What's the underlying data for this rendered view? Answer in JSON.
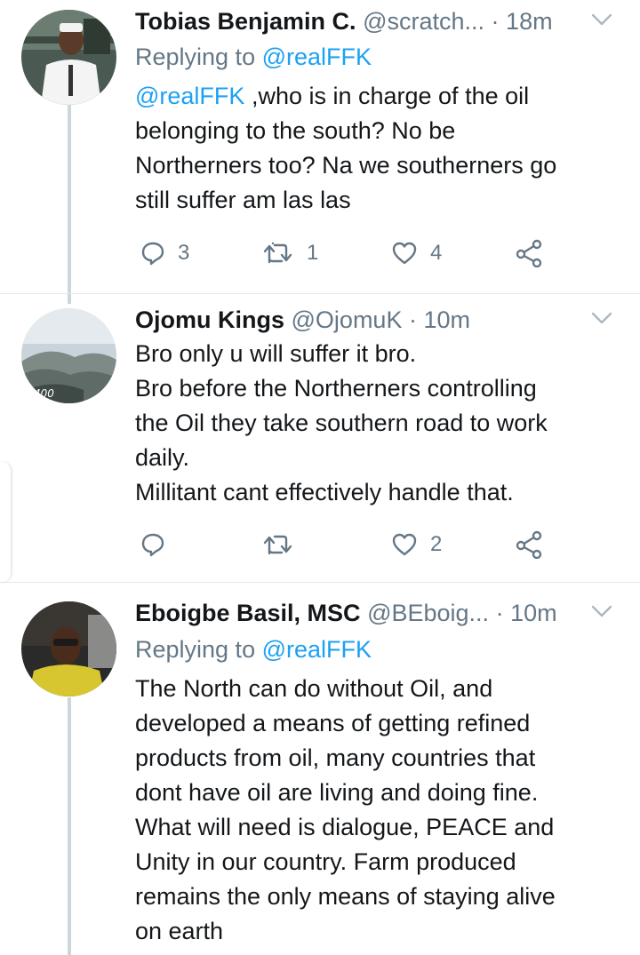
{
  "tweets": [
    {
      "name": "Tobias Benjamin C.",
      "handle": "@scratch...",
      "dot": "·",
      "time": "18m",
      "replying_prefix": "Replying to ",
      "replying_to": "@realFFK",
      "mention": "@realFFK",
      "text": " ,who is in charge of the oil\nbelonging to the south? No be\nNortherners too? Na we southerners go\nstill suffer am las las",
      "reply_count": "3",
      "retweet_count": "1",
      "like_count": "4"
    },
    {
      "name": "Ojomu Kings",
      "handle": "@OjomuK",
      "dot": "·",
      "time": "10m",
      "text": "Bro only u will suffer it bro.\nBro before the Northerners controlling\nthe Oil they take southern road to work\ndaily.\nMillitant cant effectively handle that.",
      "reply_count": "",
      "retweet_count": "",
      "like_count": "2",
      "avatar_label": "400"
    },
    {
      "name": "Eboigbe Basil, MSC",
      "handle": "@BEboig...",
      "dot": "·",
      "time": "10m",
      "replying_prefix": "Replying to ",
      "replying_to": "@realFFK",
      "text": "The North can do without Oil, and\ndeveloped a means of getting refined\nproducts from oil, many countries that\ndont have oil are living and doing fine.\nWhat will need is dialogue, PEACE and\nUnity in our country. Farm produced\nremains the only means of staying alive\non earth"
    }
  ],
  "colors": {
    "text": "#14171a",
    "secondary": "#657786",
    "link": "#1da1f2",
    "thread_line": "#ccd6dd",
    "divider": "#e1e8ed"
  },
  "icons": {
    "reply": "reply-icon",
    "retweet": "retweet-icon",
    "like": "heart-icon",
    "share": "share-icon",
    "caret": "chevron-down-icon"
  }
}
